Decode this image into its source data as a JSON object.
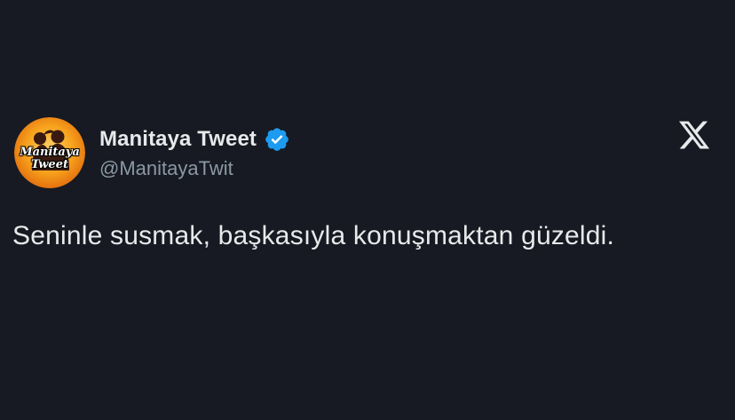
{
  "tweet": {
    "author": {
      "display_name": "Manitaya Tweet",
      "handle": "@ManitayaTwit",
      "verified": true,
      "avatar": {
        "text_line1": "Manitaya",
        "text_line2": "Tweet",
        "background_color": "#f59a1b",
        "icon": "couple-silhouette-icon"
      }
    },
    "text": "Seninle susmak, başkasıyla konuşmaktan güzeldi.",
    "platform_icon": "x-logo-icon"
  },
  "colors": {
    "background": "#171a22",
    "primary_text": "#e7e9ea",
    "secondary_text": "#8b98a5",
    "verified_blue": "#1d9bf0"
  }
}
